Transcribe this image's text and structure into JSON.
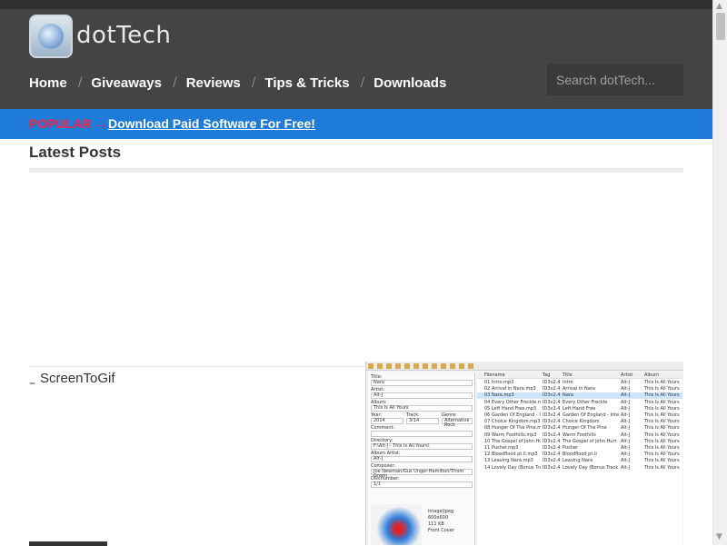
{
  "site": {
    "logo_text": "dotTech"
  },
  "nav": {
    "items": [
      "Home",
      "Giveaways",
      "Reviews",
      "Tips & Tricks",
      "Downloads"
    ],
    "separator": "/"
  },
  "search": {
    "placeholder": "Search dotTech..."
  },
  "banner": {
    "popular_label": "POPULAR",
    "arrow": "→",
    "promo_text": "Download Paid Software For Free!"
  },
  "main": {
    "section_title": "Latest Posts"
  },
  "posts": [
    {
      "title": "ScreenToGif"
    }
  ],
  "tag_editor": {
    "fields": [
      {
        "label": "Title:",
        "value": "Nara"
      },
      {
        "label": "Artist:",
        "value": "Alt-J"
      },
      {
        "label": "Album:",
        "value": "This Is All Yours"
      },
      {
        "label": "Year:",
        "value": "2014"
      },
      {
        "label": "Track:",
        "value": "3/14"
      },
      {
        "label": "Genre:",
        "value": "Alternative Rock"
      },
      {
        "label": "Comment:",
        "value": ""
      },
      {
        "label": "Directory:",
        "value": "F:\\Alt-J - This Is All Yours\\"
      },
      {
        "label": "Album Artist:",
        "value": "Alt-J"
      },
      {
        "label": "Composer:",
        "value": "Joe Newman/Gus Unger-Hamilton/Thom Green"
      },
      {
        "label": "Discnumber:",
        "value": "1/1"
      }
    ],
    "cover_info": [
      "image/jpeg",
      "600x600",
      "111 KB",
      "Front Cover"
    ],
    "columns": [
      "Filename",
      "Tag",
      "Title",
      "Artist",
      "Album"
    ],
    "rows": [
      [
        "01 Intro.mp3",
        "ID3v2.4",
        "Intro",
        "Alt-J",
        "This Is All Yours"
      ],
      [
        "02 Arrival in Nara.mp3",
        "ID3v2.4",
        "Arrival in Nara",
        "Alt-J",
        "This Is All Yours"
      ],
      [
        "03 Nara.mp3",
        "ID3v2.4",
        "Nara",
        "Alt-J",
        "This Is All Yours"
      ],
      [
        "04 Every Other Freckle.mp3",
        "ID3v2.4",
        "Every Other Freckle",
        "Alt-J",
        "This Is All Yours"
      ],
      [
        "05 Left Hand Free.mp3",
        "ID3v2.4",
        "Left Hand Free",
        "Alt-J",
        "This Is All Yours"
      ],
      [
        "06 Garden Of England - Int...",
        "ID3v2.4",
        "Garden Of England - Interlu...",
        "Alt-J",
        "This Is All Yours"
      ],
      [
        "07 Choice Kingdom.mp3",
        "ID3v2.4",
        "Choice Kingdom",
        "Alt-J",
        "This Is All Yours"
      ],
      [
        "08 Hunger Of The Pine.mp3",
        "ID3v2.4",
        "Hunger Of The Pine",
        "Alt-J",
        "This Is All Yours"
      ],
      [
        "09 Warm Foothills.mp3",
        "ID3v2.4",
        "Warm Foothills",
        "Alt-J",
        "This Is All Yours"
      ],
      [
        "10 The Gospel of John Hurt...",
        "ID3v2.4",
        "The Gospel of John Hurt",
        "Alt-J",
        "This Is All Yours"
      ],
      [
        "11 Pusher.mp3",
        "ID3v2.4",
        "Pusher",
        "Alt-J",
        "This Is All Yours"
      ],
      [
        "12 Bloodflood pt.II.mp3",
        "ID3v2.4",
        "Bloodflood pt.II",
        "Alt-J",
        "This Is All Yours"
      ],
      [
        "13 Leaving Nara.mp3",
        "ID3v2.4",
        "Leaving Nara",
        "Alt-J",
        "This Is All Yours"
      ],
      [
        "14 Lovely Day (Bonus Track)...",
        "ID3v2.4",
        "Lovely Day (Bonus Track)",
        "Alt-J",
        "This Is All Yours"
      ]
    ],
    "selected_row": 2
  },
  "colors": {
    "header_bg": "#444444",
    "banner_bg": "#1f7bd8",
    "popular_red": "#ff1f3c"
  }
}
